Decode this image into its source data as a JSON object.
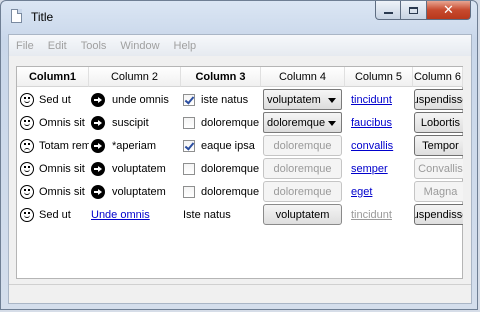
{
  "window": {
    "title": "Title"
  },
  "menu": [
    "File",
    "Edit",
    "Tools",
    "Window",
    "Help"
  ],
  "table": {
    "columns": [
      "Column1",
      "Column 2",
      "Column 3",
      "Column 4",
      "Column 5",
      "Column 6"
    ],
    "rows": [
      {
        "c1": "Sed ut",
        "c1_icon": "smile-icon",
        "c2": "unde omnis",
        "c2_type": "arrow",
        "c3": "iste natus",
        "c3_checked": true,
        "c4": "voluptatem",
        "c4_type": "combo",
        "c5": "tincidunt",
        "c5_enabled": true,
        "c6": "uspendisse",
        "c6_enabled": true
      },
      {
        "c1": "Omnis sit",
        "c1_icon": "smile-icon",
        "c2": "suscipit",
        "c2_type": "arrow",
        "c3": "doloremque",
        "c3_checked": false,
        "c4": "doloremque",
        "c4_type": "combo",
        "c5": "faucibus",
        "c5_enabled": true,
        "c6": "Lobortis",
        "c6_enabled": true
      },
      {
        "c1": "Totam rem",
        "c1_icon": "sad-face-icon",
        "c2": "*aperiam",
        "c2_type": "arrow",
        "c3": "eaque ipsa",
        "c3_checked": true,
        "c4": "doloremque",
        "c4_type": "button-disabled",
        "c5": "convallis",
        "c5_enabled": true,
        "c6": "Tempor",
        "c6_enabled": true
      },
      {
        "c1": "Omnis sit",
        "c1_icon": "smile-icon",
        "c2": "voluptatem",
        "c2_type": "arrow",
        "c3": "doloremque",
        "c3_checked": false,
        "c4": "doloremque",
        "c4_type": "button-disabled",
        "c5": "semper",
        "c5_enabled": true,
        "c6": "Convallis",
        "c6_enabled": false
      },
      {
        "c1": "Omnis sit",
        "c1_icon": "smile-icon",
        "c2": "voluptatem",
        "c2_type": "arrow",
        "c3": "doloremque",
        "c3_checked": false,
        "c4": "doloremque",
        "c4_type": "button-disabled",
        "c5": "eget",
        "c5_enabled": true,
        "c6": "Magna",
        "c6_enabled": false
      },
      {
        "c1": "Sed ut",
        "c1_icon": "smile-icon",
        "c2": "Unde omnis",
        "c2_type": "link",
        "c3": "Iste natus",
        "c3_type": "text",
        "c4": "voluptatem",
        "c4_type": "button",
        "c5": "tincidunt",
        "c5_enabled": false,
        "c6": "uspendisse",
        "c6_enabled": true
      }
    ]
  }
}
